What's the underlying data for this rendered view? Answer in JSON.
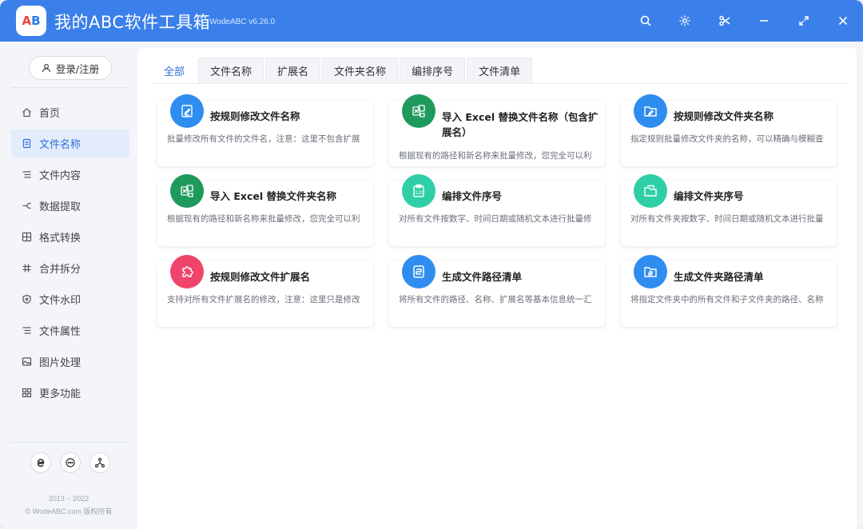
{
  "window": {
    "title": "我的ABC软件工具箱",
    "version": "WodeABC v6.26.0",
    "logo_text_a": "A",
    "logo_text_b": "B"
  },
  "titlebar_buttons": [
    "search-icon",
    "gear-icon",
    "scissors-icon",
    "minimize-icon",
    "maximize-icon",
    "close-icon"
  ],
  "sidebar": {
    "login_label": "登录/注册",
    "items": [
      {
        "label": "首页",
        "icon": "home-icon"
      },
      {
        "label": "文件名称",
        "icon": "file-icon",
        "active": true
      },
      {
        "label": "文件内容",
        "icon": "list-icon"
      },
      {
        "label": "数据提取",
        "icon": "extract-icon"
      },
      {
        "label": "格式转换",
        "icon": "convert-icon"
      },
      {
        "label": "合并拆分",
        "icon": "hash-icon"
      },
      {
        "label": "文件水印",
        "icon": "shield-icon"
      },
      {
        "label": "文件属性",
        "icon": "list-icon"
      },
      {
        "label": "图片处理",
        "icon": "image-icon"
      },
      {
        "label": "更多功能",
        "icon": "grid-icon"
      }
    ],
    "footer_icons": [
      "ie-icon",
      "chat-icon",
      "share-icon"
    ],
    "copyright_years": "2013 ~ 2022",
    "copyright_text": "© WodeABC.com 版权所有"
  },
  "tabs": [
    {
      "label": "全部",
      "active": true
    },
    {
      "label": "文件名称"
    },
    {
      "label": "扩展名"
    },
    {
      "label": "文件夹名称"
    },
    {
      "label": "编排序号"
    },
    {
      "label": "文件清单"
    }
  ],
  "cards": [
    {
      "title": "按规则修改文件名称",
      "desc": "批量修改所有文件的文件名，注意：这里不包含扩展",
      "icon": "edit-file-icon",
      "color": "#2f8df0"
    },
    {
      "title": "导入 Excel 替换文件名称（包含扩展名）",
      "desc": "根据现有的路径和新名称来批量修改，您完全可以利",
      "icon": "excel-icon",
      "color": "#1e9a5c"
    },
    {
      "title": "按规则修改文件夹名称",
      "desc": "指定规则批量修改文件夹的名称，可以精确与模糊查",
      "icon": "edit-folder-icon",
      "color": "#2f8df0"
    },
    {
      "title": "导入 Excel 替换文件夹名称",
      "desc": "根据现有的路径和新名称来批量修改，您完全可以利",
      "icon": "excel-icon",
      "color": "#1e9a5c"
    },
    {
      "title": "编排文件序号",
      "desc": "对所有文件按数字、时间日期或随机文本进行批量修",
      "icon": "sequence-file-icon",
      "color": "#2ecfa6"
    },
    {
      "title": "编排文件夹序号",
      "desc": "对所有文件夹按数字、时间日期或随机文本进行批量",
      "icon": "sequence-folder-icon",
      "color": "#2ecfa6"
    },
    {
      "title": "按规则修改文件扩展名",
      "desc": "支持对所有文件扩展名的修改，注意：这里只是修改",
      "icon": "puzzle-icon",
      "color": "#f0456a"
    },
    {
      "title": "生成文件路径清单",
      "desc": "将所有文件的路径、名称、扩展名等基本信息统一汇",
      "icon": "path-list-icon",
      "color": "#2f8df0"
    },
    {
      "title": "生成文件夹路径清单",
      "desc": "将指定文件夹中的所有文件和子文件夹的路径、名称",
      "icon": "folder-path-icon",
      "color": "#2f8df0"
    }
  ]
}
